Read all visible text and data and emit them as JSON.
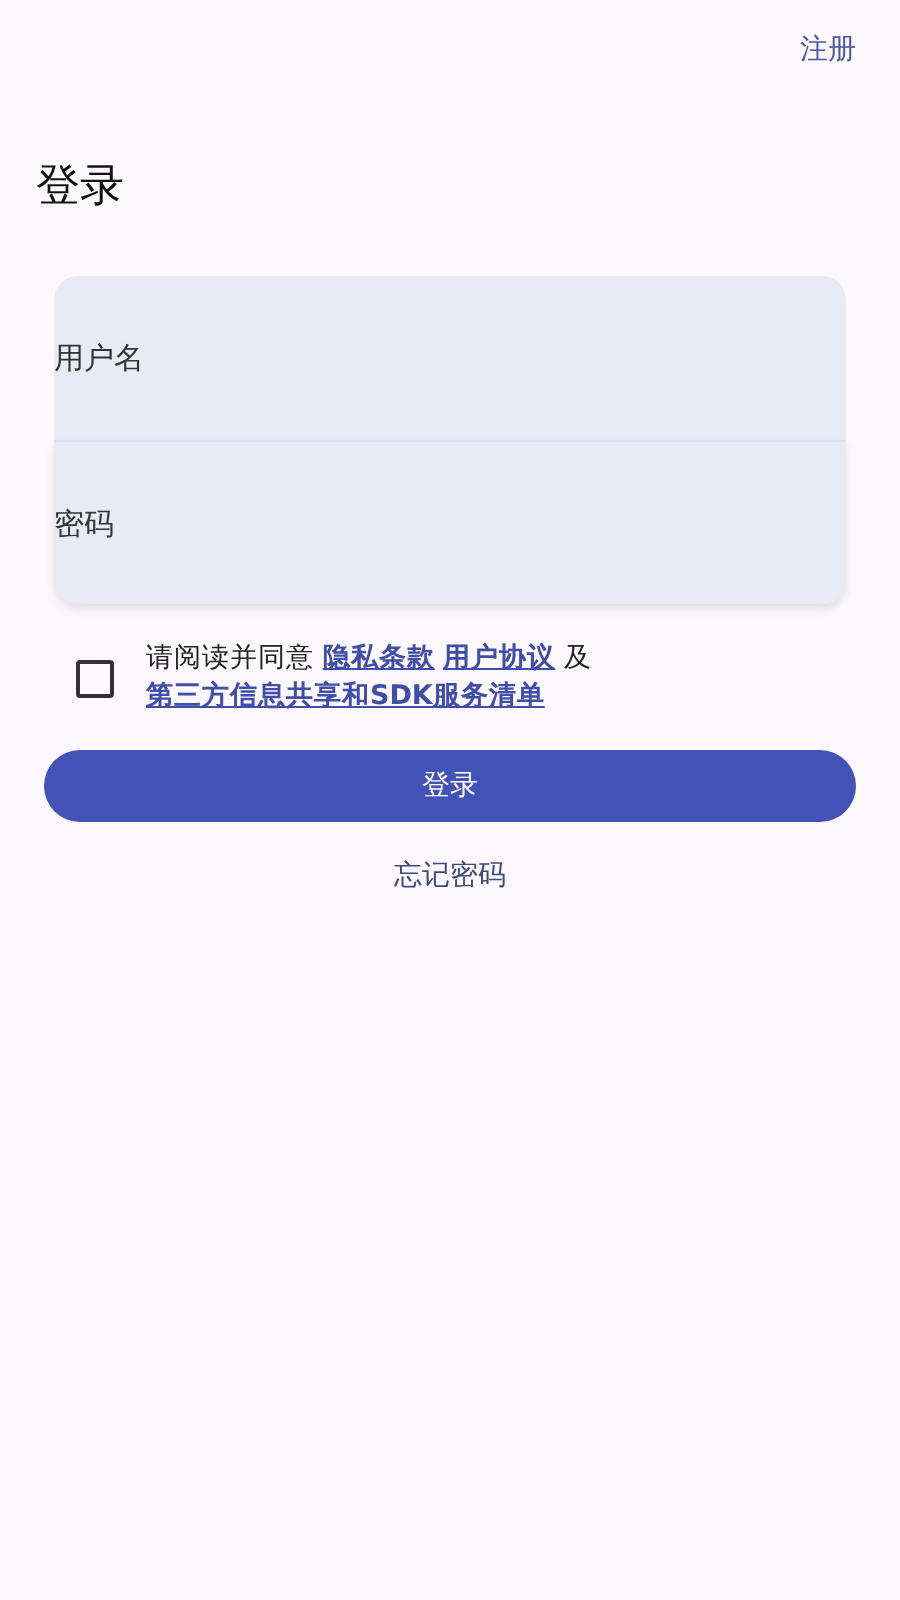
{
  "header": {
    "register_link": "注册"
  },
  "title": "登录",
  "form": {
    "fields": [
      {
        "placeholder": "用户名"
      },
      {
        "placeholder": "密码"
      }
    ]
  },
  "agreement": {
    "checked": false,
    "segments": [
      {
        "kind": "text",
        "text": "请阅读并同意"
      },
      {
        "kind": "link",
        "text": "隐私条款"
      },
      {
        "kind": "link",
        "text": "用户协议"
      },
      {
        "kind": "text",
        "text": "及"
      },
      {
        "kind": "link",
        "text": "第三方信息共享和SDK服务清单"
      }
    ]
  },
  "login_button": "登录",
  "forgot_link": "忘记密码"
}
